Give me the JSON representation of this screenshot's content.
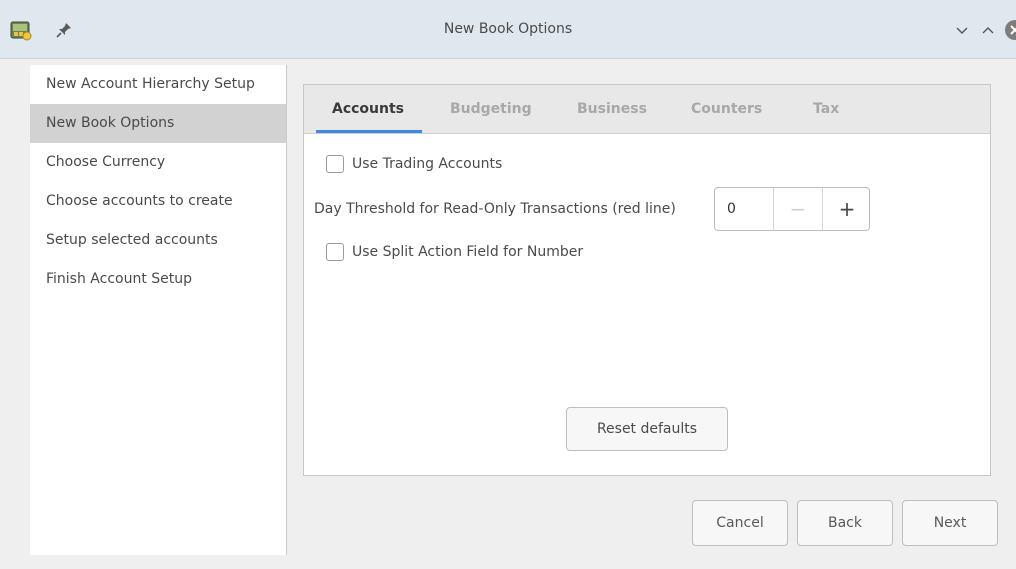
{
  "window": {
    "title": "New Book Options",
    "icons": [
      "app-icon",
      "pin-icon",
      "minimize-icon",
      "maximize-icon",
      "close-icon"
    ]
  },
  "sidebar": {
    "items": [
      {
        "label": "New Account Hierarchy Setup",
        "active": false
      },
      {
        "label": "New Book Options",
        "active": true
      },
      {
        "label": "Choose Currency",
        "active": false
      },
      {
        "label": "Choose accounts to create",
        "active": false
      },
      {
        "label": "Setup selected accounts",
        "active": false
      },
      {
        "label": "Finish Account Setup",
        "active": false
      }
    ]
  },
  "tabs": [
    {
      "label": "Accounts",
      "active": true
    },
    {
      "label": "Budgeting",
      "active": false
    },
    {
      "label": "Business",
      "active": false
    },
    {
      "label": "Counters",
      "active": false
    },
    {
      "label": "Tax",
      "active": false
    }
  ],
  "accounts_tab": {
    "use_trading_label": "Use Trading Accounts",
    "use_trading_checked": false,
    "threshold_label": "Day Threshold for Read-Only Transactions (red line)",
    "threshold_value": "0",
    "minus": "−",
    "plus": "+",
    "split_action_label": "Use Split Action Field for Number",
    "split_action_checked": false,
    "reset_label": "Reset defaults"
  },
  "footer": {
    "cancel": "Cancel",
    "back": "Back",
    "next": "Next"
  },
  "colors": {
    "accent": "#3a8be0",
    "titlebar": "#dfe8ee",
    "close": "#7d7d7d"
  }
}
